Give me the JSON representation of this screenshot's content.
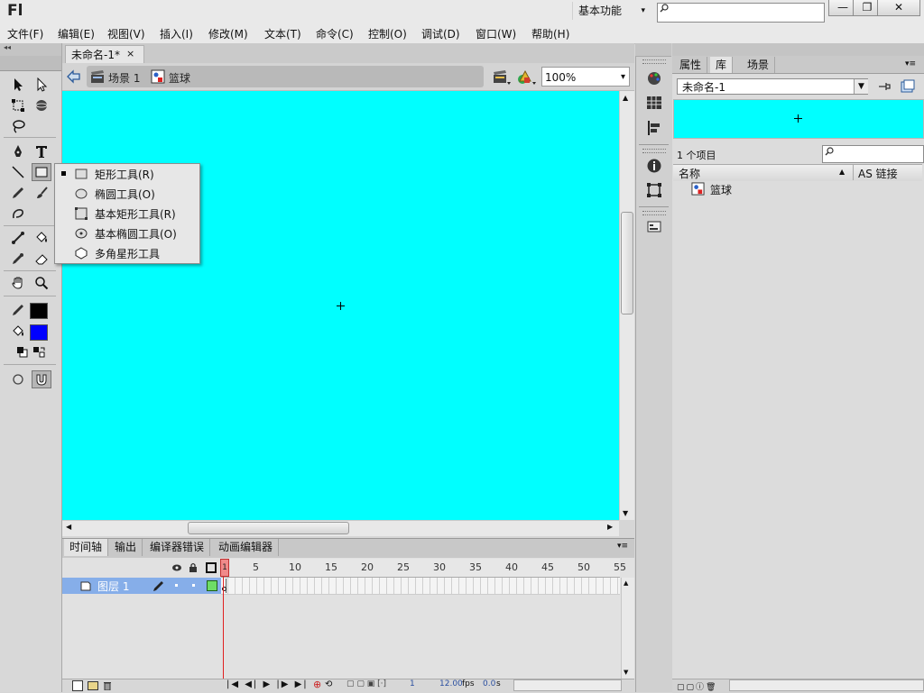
{
  "titlebar": {
    "logo": "Fl",
    "workspace_label": "基本功能",
    "workspace_chevron": "▾",
    "search_placeholder": "",
    "minimize": "—",
    "restore": "❐",
    "close": "✕"
  },
  "menubar": {
    "items": [
      "文件(F)",
      "编辑(E)",
      "视图(V)",
      "插入(I)",
      "修改(M)",
      "文本(T)",
      "命令(C)",
      "控制(O)",
      "调试(D)",
      "窗口(W)",
      "帮助(H)"
    ]
  },
  "document": {
    "tab_label": "未命名-1*",
    "tab_close": "×",
    "scene_label": "场景 1",
    "symbol_label": "篮球",
    "zoom": "100%",
    "zoom_chevron": "▾",
    "stage_color": "#00ffff"
  },
  "tool_popup": {
    "items": [
      {
        "label": "矩形工具(R)",
        "icon": "rectangle-icon",
        "selected": true
      },
      {
        "label": "椭圆工具(O)",
        "icon": "oval-icon",
        "selected": false
      },
      {
        "label": "基本矩形工具(R)",
        "icon": "primitive-rectangle-icon",
        "selected": false
      },
      {
        "label": "基本椭圆工具(O)",
        "icon": "primitive-oval-icon",
        "selected": false
      },
      {
        "label": "多角星形工具",
        "icon": "polystar-icon",
        "selected": false
      }
    ]
  },
  "colors": {
    "stroke": "#000000",
    "fill": "#0000ff"
  },
  "timeline": {
    "tabs": [
      "时间轴",
      "输出",
      "编译器错误",
      "动画编辑器"
    ],
    "active_tab": "时间轴",
    "frame_numbers": [
      "1",
      "5",
      "10",
      "15",
      "20",
      "25",
      "30",
      "35",
      "40",
      "45",
      "50",
      "55"
    ],
    "layer_name": "图层 1",
    "current_frame": "1",
    "fps": "12.00",
    "fps_unit": "fps",
    "elapsed": "0.0",
    "elapsed_unit": "s"
  },
  "library": {
    "tabs": [
      "属性",
      "库",
      "场景"
    ],
    "active_tab": "库",
    "document_select": "未命名-1",
    "item_count": "1 个项目",
    "col_name": "名称",
    "col_linkage": "AS 链接",
    "items": [
      {
        "name": "篮球",
        "icon": "movieclip-icon"
      }
    ]
  }
}
